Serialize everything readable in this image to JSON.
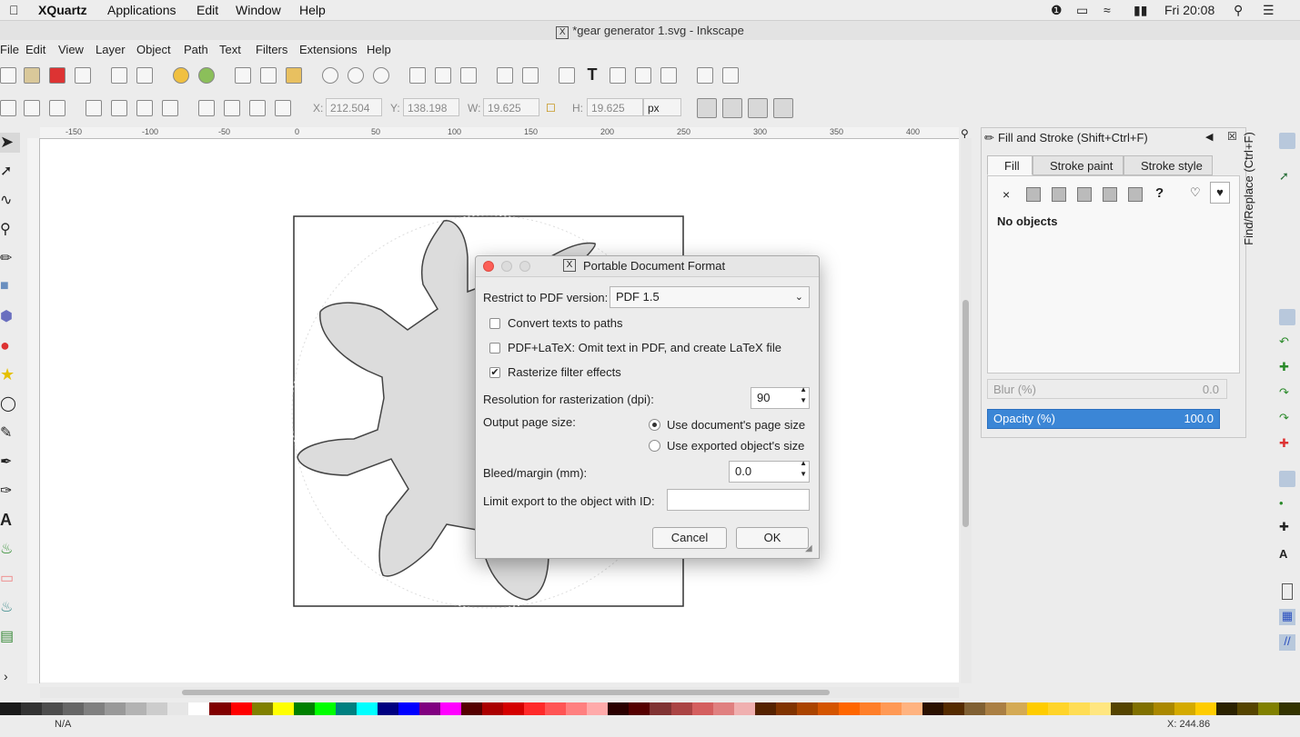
{
  "macbar": {
    "app": "XQuartz",
    "menus": [
      "Applications",
      "Edit",
      "Window",
      "Help"
    ],
    "clock": "Fri 20:08"
  },
  "window": {
    "title": "*gear generator 1.svg - Inkscape"
  },
  "menubar": [
    "File",
    "Edit",
    "View",
    "Layer",
    "Object",
    "Path",
    "Text",
    "Filters",
    "Extensions",
    "Help"
  ],
  "toolctl": {
    "x_label": "X:",
    "x_value": "212.504",
    "y_label": "Y:",
    "y_value": "138.198",
    "w_label": "W:",
    "w_value": "19.625",
    "h_label": "H:",
    "h_value": "19.625",
    "unit": "px"
  },
  "ruler": [
    "-150",
    "-100",
    "-50",
    "0",
    "50",
    "100",
    "150",
    "200",
    "250",
    "300",
    "350",
    "400"
  ],
  "dock": {
    "title": "Fill and Stroke (Shift+Ctrl+F)",
    "tabs": [
      "Fill",
      "Stroke paint",
      "Stroke style"
    ],
    "no_objects": "No objects",
    "unknown_glyph": "?",
    "flat_glyph": "×",
    "blur_label": "Blur (%)",
    "blur_value": "0.0",
    "opacity_label": "Opacity (%)",
    "opacity_value": "100.0",
    "vertical_tab": "Find/Replace (Ctrl+F)"
  },
  "dialog": {
    "title": "Portable Document Format",
    "pdf_version_label": "Restrict to PDF version:",
    "pdf_version_value": "PDF 1.5",
    "convert_texts": "Convert texts to paths",
    "convert_texts_checked": false,
    "pdf_latex": "PDF+LaTeX: Omit text in PDF, and create LaTeX file",
    "pdf_latex_checked": false,
    "rasterize": "Rasterize filter effects",
    "rasterize_checked": true,
    "check_mark": "✔",
    "resolution_label": "Resolution for rasterization (dpi):",
    "resolution_value": "90",
    "page_size_label": "Output page size:",
    "page_size_doc": "Use document's page size",
    "page_size_obj": "Use exported object's size",
    "bleed_label": "Bleed/margin (mm):",
    "bleed_value": "0.0",
    "limit_label": "Limit export to the object with ID:",
    "limit_value": "",
    "cancel": "Cancel",
    "ok": "OK"
  },
  "statusbar": {
    "layer": "N/A",
    "coords": "X: 244.86"
  },
  "palette": [
    "#1a1a1a",
    "#333",
    "#4d4d4d",
    "#666",
    "#808080",
    "#999",
    "#b3b3b3",
    "#ccc",
    "#e6e6e6",
    "#fff",
    "#800000",
    "#ff0000",
    "#808000",
    "#ffff00",
    "#008000",
    "#00ff00",
    "#008080",
    "#00ffff",
    "#000080",
    "#0000ff",
    "#800080",
    "#ff00ff",
    "#550000",
    "#aa0000",
    "#d40000",
    "#ff2a2a",
    "#ff5555",
    "#ff8080",
    "#ffaaaa",
    "#2b0000",
    "#550000",
    "#803333",
    "#aa4444",
    "#d45f5f",
    "#e08080",
    "#f0b0b0",
    "#552200",
    "#803300",
    "#aa4400",
    "#d45500",
    "#ff6600",
    "#ff7f2a",
    "#ff9955",
    "#ffb380",
    "#2b1100",
    "#552b00",
    "#806033",
    "#aa7f44",
    "#d4aa55",
    "#ffcc00",
    "#ffd42a",
    "#ffdd55",
    "#ffe680",
    "#554400",
    "#807000",
    "#aa8800",
    "#d4aa00",
    "#ffcc00",
    "#2b2200",
    "#554400",
    "#808000",
    "#333300"
  ]
}
